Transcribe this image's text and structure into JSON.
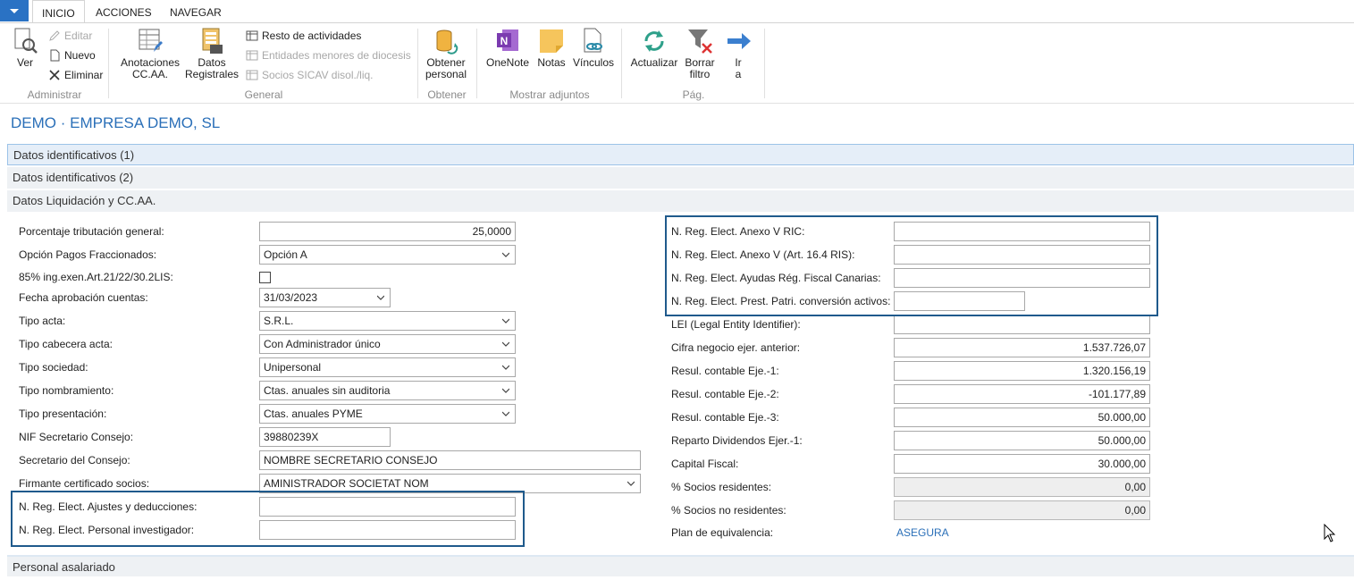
{
  "tabs": [
    "INICIO",
    "ACCIONES",
    "NAVEGAR"
  ],
  "ribbon": {
    "administrar": {
      "label": "Administrar",
      "ver": "Ver",
      "editar": "Editar",
      "nuevo": "Nuevo",
      "eliminar": "Eliminar"
    },
    "general": {
      "label": "General",
      "anotaciones": [
        "Anotaciones",
        "CC.AA."
      ],
      "datos": [
        "Datos",
        "Registrales"
      ],
      "resto": "Resto de actividades",
      "entidades": "Entidades menores de diocesis",
      "socios": "Socios SICAV disol./liq."
    },
    "obtener": {
      "label": "Obtener",
      "personal": [
        "Obtener",
        "personal"
      ]
    },
    "adjuntos": {
      "label": "Mostrar adjuntos",
      "onenote": "OneNote",
      "notas": "Notas",
      "vinculos": "Vínculos"
    },
    "pag": {
      "label": "Pág.",
      "actualizar": "Actualizar",
      "borrar": [
        "Borrar",
        "filtro"
      ],
      "ir": [
        "Ir",
        "a"
      ]
    }
  },
  "page_title": "DEMO · EMPRESA DEMO, SL",
  "sections": {
    "s1": "Datos identificativos (1)",
    "s2": "Datos identificativos (2)",
    "s3": "Datos Liquidación y CC.AA.",
    "s4": "Personal asalariado"
  },
  "left_fields": [
    {
      "label": "Porcentaje tributación general:",
      "value": "25,0000"
    },
    {
      "label": "Opción Pagos Fraccionados:",
      "value": "Opción A"
    },
    {
      "label": "85% ing.exen.Art.21/22/30.2LIS:",
      "value": ""
    },
    {
      "label": "Fecha aprobación cuentas:",
      "value": "31/03/2023"
    },
    {
      "label": "Tipo acta:",
      "value": "S.R.L."
    },
    {
      "label": "Tipo cabecera acta:",
      "value": "Con Administrador único"
    },
    {
      "label": "Tipo sociedad:",
      "value": "Unipersonal"
    },
    {
      "label": "Tipo nombramiento:",
      "value": "Ctas. anuales sin auditoria"
    },
    {
      "label": "Tipo presentación:",
      "value": "Ctas. anuales PYME"
    },
    {
      "label": "NIF Secretario Consejo:",
      "value": "39880239X"
    },
    {
      "label": "Secretario del Consejo:",
      "value": "NOMBRE SECRETARIO CONSEJO"
    },
    {
      "label": "Firmante certificado socios:",
      "value": "AMINISTRADOR SOCIETAT NOM"
    },
    {
      "label": "N. Reg. Elect. Ajustes y deducciones:",
      "value": ""
    },
    {
      "label": "N. Reg. Elect. Personal investigador:",
      "value": ""
    }
  ],
  "right_fields": [
    {
      "label": "N. Reg. Elect. Anexo V RIC:",
      "value": ""
    },
    {
      "label": "N. Reg. Elect. Anexo V (Art. 16.4 RIS):",
      "value": ""
    },
    {
      "label": "N. Reg. Elect. Ayudas Rég. Fiscal Canarias:",
      "value": ""
    },
    {
      "label": "N. Reg. Elect. Prest. Patri. conversión activos:",
      "value": ""
    },
    {
      "label": "LEI (Legal Entity Identifier):",
      "value": ""
    },
    {
      "label": "Cifra negocio ejer. anterior:",
      "value": "1.537.726,07"
    },
    {
      "label": "Resul. contable Eje.-1:",
      "value": "1.320.156,19"
    },
    {
      "label": "Resul. contable Eje.-2:",
      "value": "-101.177,89"
    },
    {
      "label": "Resul. contable Eje.-3:",
      "value": "50.000,00"
    },
    {
      "label": "Reparto Dividendos Ejer.-1:",
      "value": "50.000,00"
    },
    {
      "label": "Capital Fiscal:",
      "value": "30.000,00"
    },
    {
      "label": "% Socios residentes:",
      "value": "0,00"
    },
    {
      "label": "% Socios no residentes:",
      "value": "0,00"
    },
    {
      "label": "Plan de equivalencia:",
      "value": "ASEGURA"
    }
  ],
  "colors": {
    "accent": "#2a6fb8",
    "highlight": "#1f5a8c",
    "app_button": "#2a72c4"
  }
}
